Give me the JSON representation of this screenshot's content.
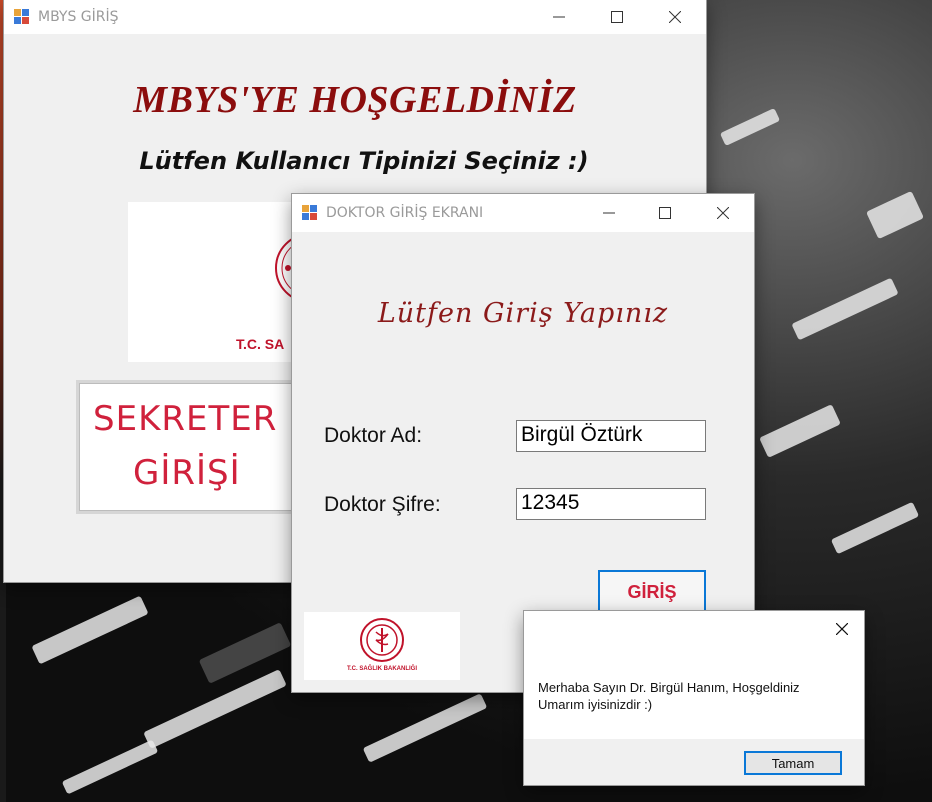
{
  "desktop": {
    "background": "dark mountain rocks wallpaper"
  },
  "main_window": {
    "title": "MBYS GİRİŞ",
    "header": "MBYS'YE HOŞGELDİNİZ",
    "subheader": "Lütfen Kullanıcı Tipinizi Seçiniz  :)",
    "logo_text": "T.C. SA",
    "secretary_button": {
      "line1": "SEKRETER",
      "line2": "GİRİŞİ"
    }
  },
  "doctor_window": {
    "title": "DOKTOR GİRİŞ EKRANI",
    "prompt": "Lütfen Giriş Yapınız",
    "name_label": "Doktor Ad:",
    "name_value": "Birgül Öztürk",
    "password_label": "Doktor Şifre:",
    "password_value": "12345",
    "login_button": "GİRİŞ",
    "logo_caption": "T.C. SAĞLIK BAKANLIĞI"
  },
  "message_box": {
    "line1": "Merhaba Sayın Dr. Birgül Hanım, Hoşgeldiniz",
    "line2": "Umarım iyisinizdir  :)",
    "ok_button": "Tamam"
  },
  "colors": {
    "accent_red": "#d0213c",
    "header_maroon": "#8b0d0d",
    "focus_blue": "#0a78d7"
  }
}
